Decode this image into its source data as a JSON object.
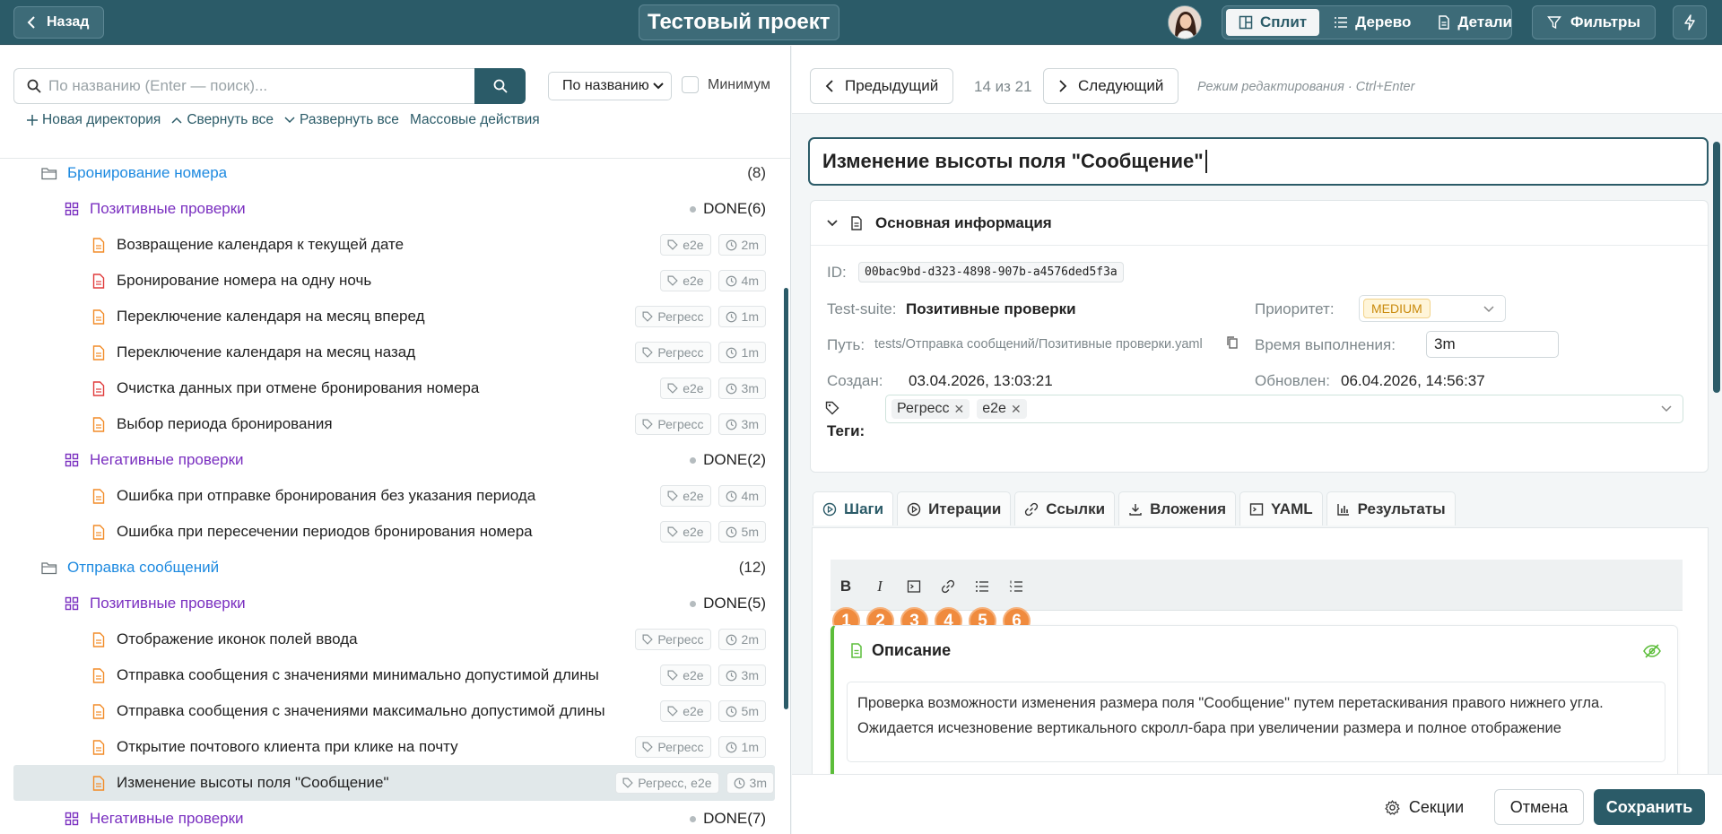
{
  "topbar": {
    "back_label": "Назад",
    "project_title": "Тестовый проект",
    "views": [
      "Сплит",
      "Дерево",
      "Детали"
    ],
    "active_view": "Сплит",
    "filters_label": "Фильтры"
  },
  "left": {
    "search_placeholder": "По названию (Enter — поиск)...",
    "sort_value": "По названию",
    "minimum_label": "Минимум",
    "actions": {
      "new_dir": "Новая директория",
      "collapse_all": "Свернуть все",
      "expand_all": "Развернуть все",
      "bulk": "Массовые действия"
    },
    "tree": [
      {
        "kind": "dir",
        "name": "Бронирование номера",
        "count": "(8)"
      },
      {
        "kind": "suite",
        "name": "Позитивные проверки",
        "status": "DONE",
        "count": "(6)"
      },
      {
        "kind": "case",
        "name": "Возвращение календаря к текущей дате",
        "tag": "e2e",
        "time": "2m",
        "color": "#f28c28"
      },
      {
        "kind": "case",
        "name": "Бронирование номера на одну ночь",
        "tag": "e2e",
        "time": "4m",
        "color": "#e03b3b"
      },
      {
        "kind": "case",
        "name": "Переключение календаря на месяц вперед",
        "tag": "Регресс",
        "time": "1m",
        "color": "#f28c28"
      },
      {
        "kind": "case",
        "name": "Переключение календаря на месяц назад",
        "tag": "Регресс",
        "time": "1m",
        "color": "#f28c28"
      },
      {
        "kind": "case",
        "name": "Очистка данных при отмене бронирования номера",
        "tag": "e2e",
        "time": "3m",
        "color": "#e03b3b"
      },
      {
        "kind": "case",
        "name": "Выбор периода бронирования",
        "tag": "Регресс",
        "time": "3m",
        "color": "#f28c28"
      },
      {
        "kind": "suite",
        "name": "Негативные проверки",
        "status": "DONE",
        "count": "(2)"
      },
      {
        "kind": "case",
        "name": "Ошибка при отправке бронирования без указания периода",
        "tag": "e2e",
        "time": "4m",
        "color": "#f28c28"
      },
      {
        "kind": "case",
        "name": "Ошибка при пересечении периодов бронирования номера",
        "tag": "e2e",
        "time": "5m",
        "color": "#f28c28"
      },
      {
        "kind": "dir",
        "name": "Отправка сообщений",
        "count": "(12)"
      },
      {
        "kind": "suite",
        "name": "Позитивные проверки",
        "status": "DONE",
        "count": "(5)"
      },
      {
        "kind": "case",
        "name": "Отображение иконок полей ввода",
        "tag": "Регресс",
        "time": "2m",
        "color": "#f28c28"
      },
      {
        "kind": "case",
        "name": "Отправка сообщения с значениями минимально допустимой длины",
        "tag": "e2e",
        "time": "3m",
        "color": "#f28c28"
      },
      {
        "kind": "case",
        "name": "Отправка сообщения с значениями максимально допустимой длины",
        "tag": "e2e",
        "time": "5m",
        "color": "#f28c28"
      },
      {
        "kind": "case",
        "name": "Открытие почтового клиента при клике на почту",
        "tag": "Регресс",
        "time": "1m",
        "color": "#f28c28"
      },
      {
        "kind": "case",
        "name": "Изменение высоты поля \"Сообщение\"",
        "tag": "Регресс, e2e",
        "time": "3m",
        "color": "#f28c28",
        "selected": true
      },
      {
        "kind": "suite",
        "name": "Негативные проверки",
        "status": "DONE",
        "count": "(7)"
      }
    ]
  },
  "right": {
    "prev_label": "Предыдущий",
    "position": "14 из 21",
    "next_label": "Следующий",
    "edit_hint": "Режим редактирования · Ctrl+Enter",
    "title": "Изменение высоты поля \"Сообщение\"",
    "info": {
      "section_title": "Основная информация",
      "id_label": "ID:",
      "id_value": "00bac9bd-d323-4898-907b-a4576ded5f3a",
      "suite_label": "Test-suite:",
      "suite_value": "Позитивные проверки",
      "priority_label": "Приоритет:",
      "priority_value": "MEDIUM",
      "path_label": "Путь:",
      "path_value": "tests/Отправка сообщений/Позитивные проверки.yaml",
      "duration_label": "Время выполнения:",
      "duration_value": "3m",
      "created_label": "Создан:",
      "created_value": "03.04.2026, 13:03:21",
      "updated_label": "Обновлен:",
      "updated_value": "06.04.2026, 14:56:37",
      "tags_label": "Теги:",
      "tags": [
        "Регресс",
        "e2e"
      ]
    },
    "tabs": [
      "Шаги",
      "Итерации",
      "Ссылки",
      "Вложения",
      "YAML",
      "Результаты"
    ],
    "active_tab": "Шаги",
    "toolbar_badges": [
      "1",
      "2",
      "3",
      "4",
      "5",
      "6"
    ],
    "description": {
      "title": "Описание",
      "text": "Проверка возможности изменения размера поля \"Сообщение\" путем перетаскивания правого нижнего угла. Ожидается исчезновение вертикального скролл-бара при увеличении размера и полное отображение"
    },
    "footer": {
      "sections_label": "Секции",
      "cancel_label": "Отмена",
      "save_label": "Сохранить"
    }
  },
  "colors": {
    "primary": "#2b5b68",
    "dir": "#1e8ae0",
    "suite": "#7a2fc0",
    "accent_orange": "#f08b3e",
    "description_border": "#5cbd3a"
  }
}
